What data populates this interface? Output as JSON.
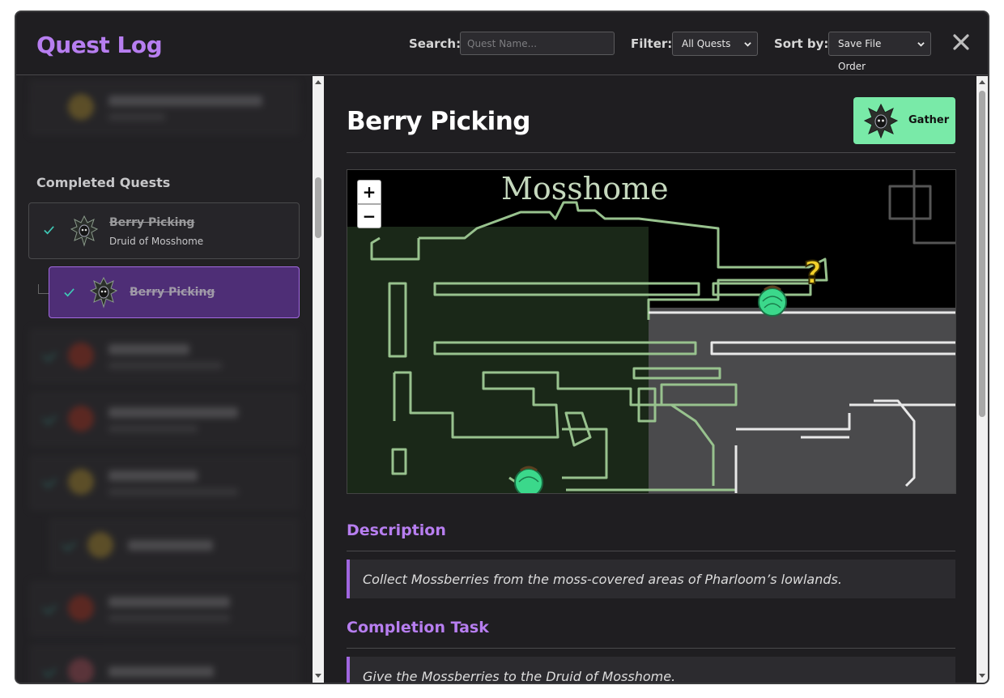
{
  "header": {
    "title": "Quest Log",
    "search_label": "Search:",
    "search_placeholder": "Quest Name...",
    "filter_label": "Filter:",
    "filter_value": "All Quests",
    "sort_label": "Sort by:",
    "sort_value": "Save File Order",
    "close_icon": "close-icon"
  },
  "sidebar": {
    "completed_heading": "Completed Quests",
    "selected_parent": {
      "name": "Berry Picking",
      "giver": "Druid of Mosshome",
      "completed": true
    },
    "selected_child": {
      "name": "Berry Picking",
      "completed": true
    }
  },
  "detail": {
    "title": "Berry Picking",
    "type_label": "Gather",
    "map": {
      "region_label": "Mosshome",
      "zoom_in": "+",
      "zoom_out": "−",
      "quest_marker": "?"
    },
    "description_heading": "Description",
    "description": "Collect Mossberries from the moss-covered areas of Pharloom’s lowlands.",
    "completion_heading": "Completion Task",
    "completion_task": "Give the Mossberries to the Druid of Mosshome."
  },
  "colors": {
    "accent": "#b77ef0",
    "selected_bg": "#4e2e76",
    "badge_bg": "#79eaa8",
    "check": "#3fc9b6"
  }
}
